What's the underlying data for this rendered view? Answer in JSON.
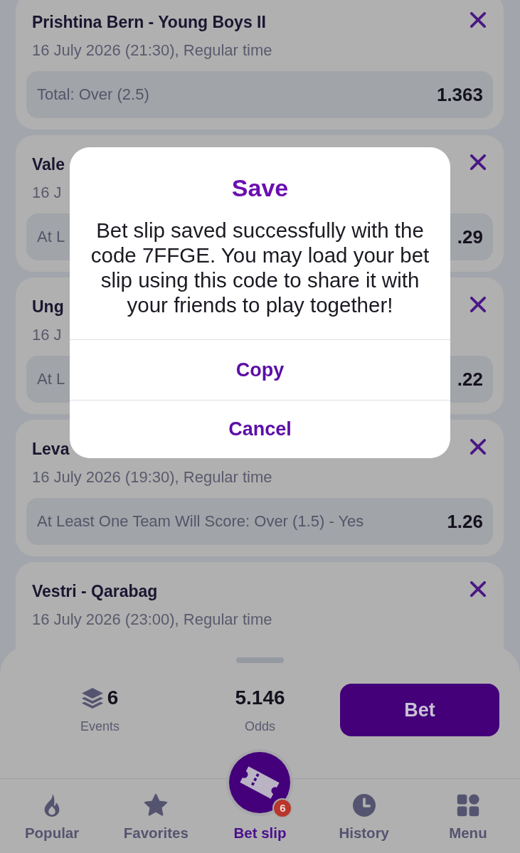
{
  "events": [
    {
      "title": "Prishtina Bern - Young Boys II",
      "datetime": "16 July 2026 (21:30), Regular time",
      "selection": "Total: Over (2.5)",
      "odds": "1.363"
    },
    {
      "title": "Vale",
      "datetime": "16 J",
      "selection": "At L",
      "odds": ".29"
    },
    {
      "title": "Ung",
      "datetime": "16 J",
      "selection": "At L",
      "odds": ".22"
    },
    {
      "title": "Leva",
      "datetime": "16 July 2026 (19:30), Regular time",
      "selection": "At Least One Team Will Score: Over (1.5) - Yes",
      "odds": "1.26"
    },
    {
      "title": "Vestri - Qarabag",
      "datetime": "16 July 2026 (23:00), Regular time"
    }
  ],
  "summary": {
    "events_count": "6",
    "events_label": "Events",
    "odds": "5.146",
    "odds_label": "Odds",
    "bet_button": "Bet"
  },
  "bottom_nav": [
    {
      "label": "Popular",
      "selected": false
    },
    {
      "label": "Favorites",
      "selected": false
    },
    {
      "label": "Bet slip",
      "selected": true,
      "badge": "6"
    },
    {
      "label": "History",
      "selected": false
    },
    {
      "label": "Menu",
      "selected": false
    }
  ],
  "dialog": {
    "title": "Save",
    "message": "Bet slip saved successfully with the code 7FFGE. You may load your bet slip using this code to share it with your friends to play together!",
    "buttons": [
      "Copy",
      "Cancel"
    ]
  }
}
